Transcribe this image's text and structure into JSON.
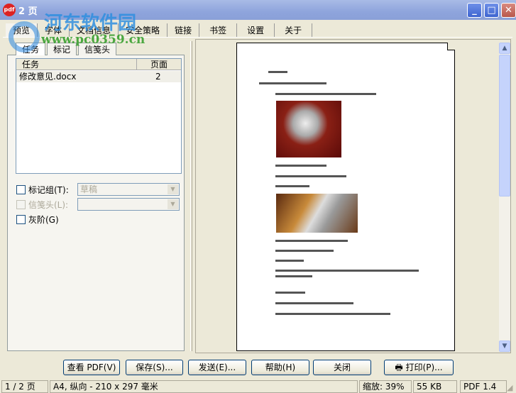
{
  "window": {
    "title": "2 页",
    "app_icon": "pdf",
    "watermark_name": "河东软件园",
    "watermark_url": "www.pc0359.cn"
  },
  "main_tabs": [
    "预览",
    "字体",
    "文档信息",
    "安全策略",
    "链接",
    "书签",
    "设置",
    "关于"
  ],
  "sub_tabs": [
    "任务",
    "标记",
    "信笺头"
  ],
  "task_list": {
    "columns": [
      "任务",
      "页面"
    ],
    "rows": [
      {
        "task": "修改意见.docx",
        "pages": "2"
      }
    ]
  },
  "options": {
    "mark_group_label": "标记组(T):",
    "mark_group_value": "草稿",
    "letterhead_label": "信笺头(L):",
    "letterhead_value": "",
    "grayscale_label": "灰阶(G)"
  },
  "buttons": {
    "view": "查看 PDF(V)",
    "save": "保存(S)...",
    "send": "发送(E)...",
    "help": "帮助(H)",
    "close": "关闭",
    "print": "打印(P)..."
  },
  "status": {
    "page": "1 / 2 页",
    "paper": "A4, 纵向 - 210 x 297 毫米",
    "zoom": "缩放: 39%",
    "size": "55 KB",
    "version": "PDF 1.4"
  }
}
